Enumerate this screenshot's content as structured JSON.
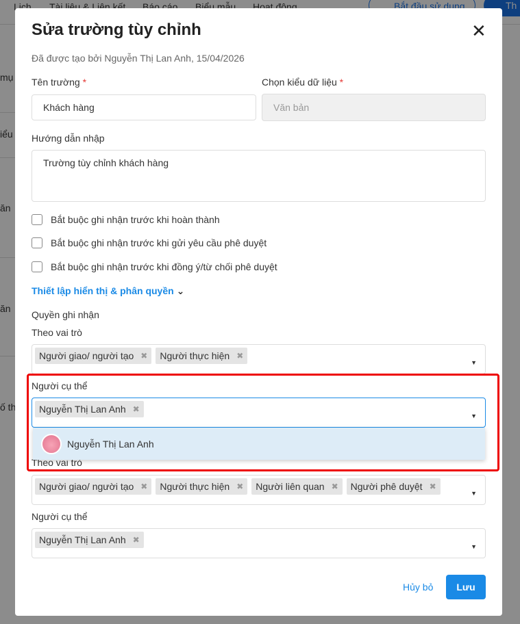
{
  "background": {
    "nav": [
      "Lịch",
      "Tài liệu & Liên kết",
      "Báo cáo",
      "Biểu mẫu",
      "Hoạt động"
    ],
    "start_button": "Bắt đầu sử dụng",
    "add_button": "Th",
    "side_fragments": [
      "mụ",
      "iểu",
      "ăn",
      "ăn",
      "ố th"
    ]
  },
  "modal": {
    "title": "Sửa trường tùy chỉnh",
    "meta": "Đã được tạo bởi Nguyễn Thị Lan Anh, 15/04/2026",
    "field_name_label": "Tên trường",
    "field_name_value": "Khách hàng",
    "data_type_label": "Chọn kiểu dữ liệu",
    "data_type_value": "Văn bản",
    "required_mark": "*",
    "guide_label": "Hướng dẫn nhập",
    "guide_value": "Trường tùy chỉnh khách hàng",
    "checkboxes": [
      "Bắt buộc ghi nhận trước khi hoàn thành",
      "Bắt buộc ghi nhận trước khi gửi yêu cầu phê duyệt",
      "Bắt buộc ghi nhận trước khi đồng ý/từ chối phê duyệt"
    ],
    "visibility_link": "Thiết lập hiển thị & phân quyền",
    "record_perm_label": "Quyền ghi nhận",
    "by_role_label": "Theo vai trò",
    "roles1": [
      "Người giao/ người tạo",
      "Người thực hiện"
    ],
    "specific_label": "Người cụ thể",
    "specific1": [
      "Nguyễn Thị Lan Anh"
    ],
    "dropdown_option": "Nguyễn Thị Lan Anh",
    "roles2": [
      "Người giao/ người tạo",
      "Người thực hiện",
      "Người liên quan",
      "Người phê duyệt"
    ],
    "specific2": [
      "Nguyễn Thị Lan Anh"
    ],
    "cancel": "Hủy bỏ",
    "save": "Lưu"
  },
  "colors": {
    "accent": "#1a8ae6",
    "highlight": "#e00000"
  }
}
